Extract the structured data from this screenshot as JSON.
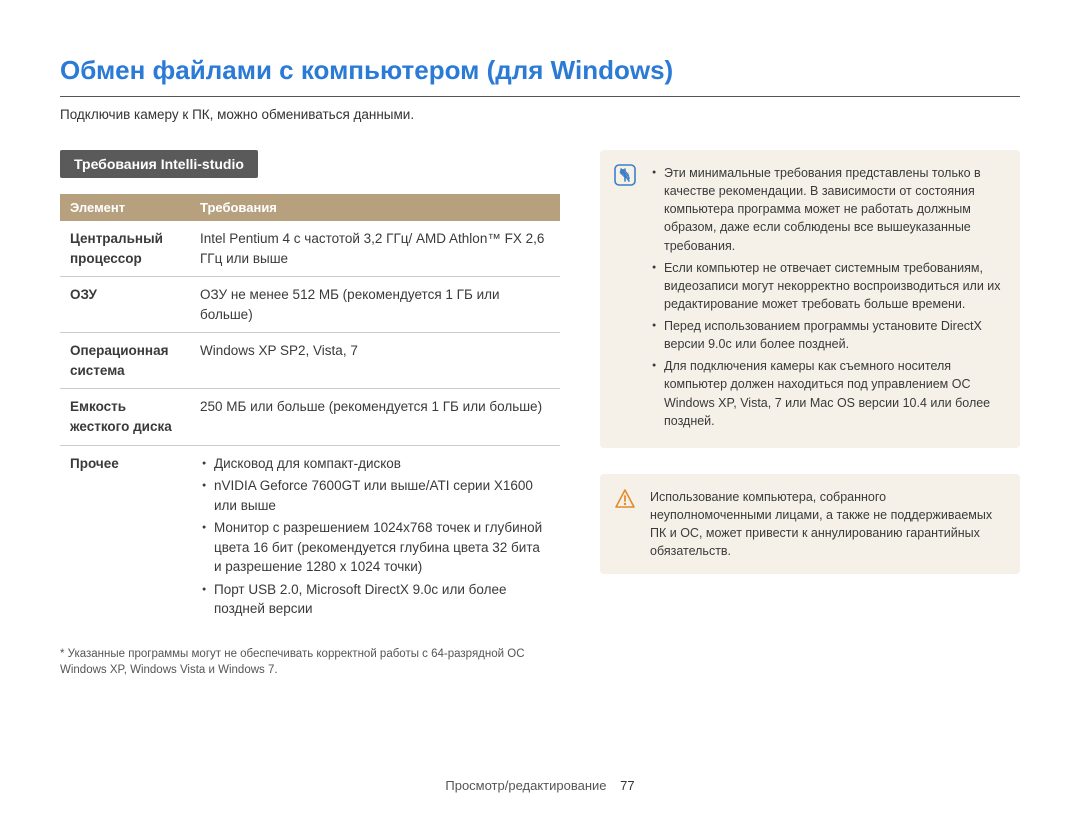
{
  "title": "Обмен файлами с компьютером (для Windows)",
  "subtitle": "Подключив камеру к ПК, можно обмениваться данными.",
  "section_heading": "Требования Intelli-studio",
  "table": {
    "head": {
      "col1": "Элемент",
      "col2": "Требования"
    },
    "rows": [
      {
        "key": "Центральный процессор",
        "val": "Intel Pentium 4 с частотой 3,2 ГГц/\nAMD Athlon™ FX 2,6 ГГц или выше"
      },
      {
        "key": "ОЗУ",
        "val": "ОЗУ не менее 512 МБ\n(рекомендуется 1 ГБ или больше)"
      },
      {
        "key": "Операционная система",
        "val": "Windows XP SP2, Vista, 7"
      },
      {
        "key": "Емкость жесткого диска",
        "val": "250 МБ или больше\n(рекомендуется 1 ГБ или больше)"
      }
    ],
    "other_key": "Прочее",
    "other_items": [
      "Дисковод для компакт-дисков",
      "nVIDIA Geforce 7600GT или выше/ATI серии X1600 или выше",
      "Монитор с разрешением 1024x768 точек и глубиной цвета 16 бит (рекомендуется глубина цвета 32 бита и разрешение 1280 x 1024 точки)",
      "Порт USB 2.0, Microsoft DirectX 9.0c или более поздней версии"
    ]
  },
  "footnote": "* Указанные программы могут не обеспечивать корректной работы с 64-разрядной ОС Windows XP, Windows Vista и Windows 7.",
  "info_notes": [
    "Эти минимальные требования представлены только в качестве рекомендации. В зависимости от состояния компьютера программа может не работать должным образом, даже если соблюдены все вышеуказанные требования.",
    "Если компьютер не отвечает системным требованиям, видеозаписи могут некорректно воспроизводиться или их редактирование может требовать больше времени.",
    "Перед использованием программы установите DirectX версии 9.0c или более поздней.",
    "Для подключения камеры как съемного носителя компьютер должен находиться под управлением ОС Windows XP, Vista, 7 или Mac OS версии 10.4 или более поздней."
  ],
  "warning_text": "Использование компьютера, собранного неуполномоченными лицами, а также не поддерживаемых ПК и ОС, может привести к аннулированию гарантийных обязательств.",
  "footer": {
    "section": "Просмотр/редактирование",
    "page": "77"
  },
  "colors": {
    "title": "#2b7bd6",
    "table_head": "#b7a07e",
    "box_bg": "#f5f1e9",
    "info_icon": "#3d7fc5",
    "warn_icon": "#e28b2a"
  }
}
